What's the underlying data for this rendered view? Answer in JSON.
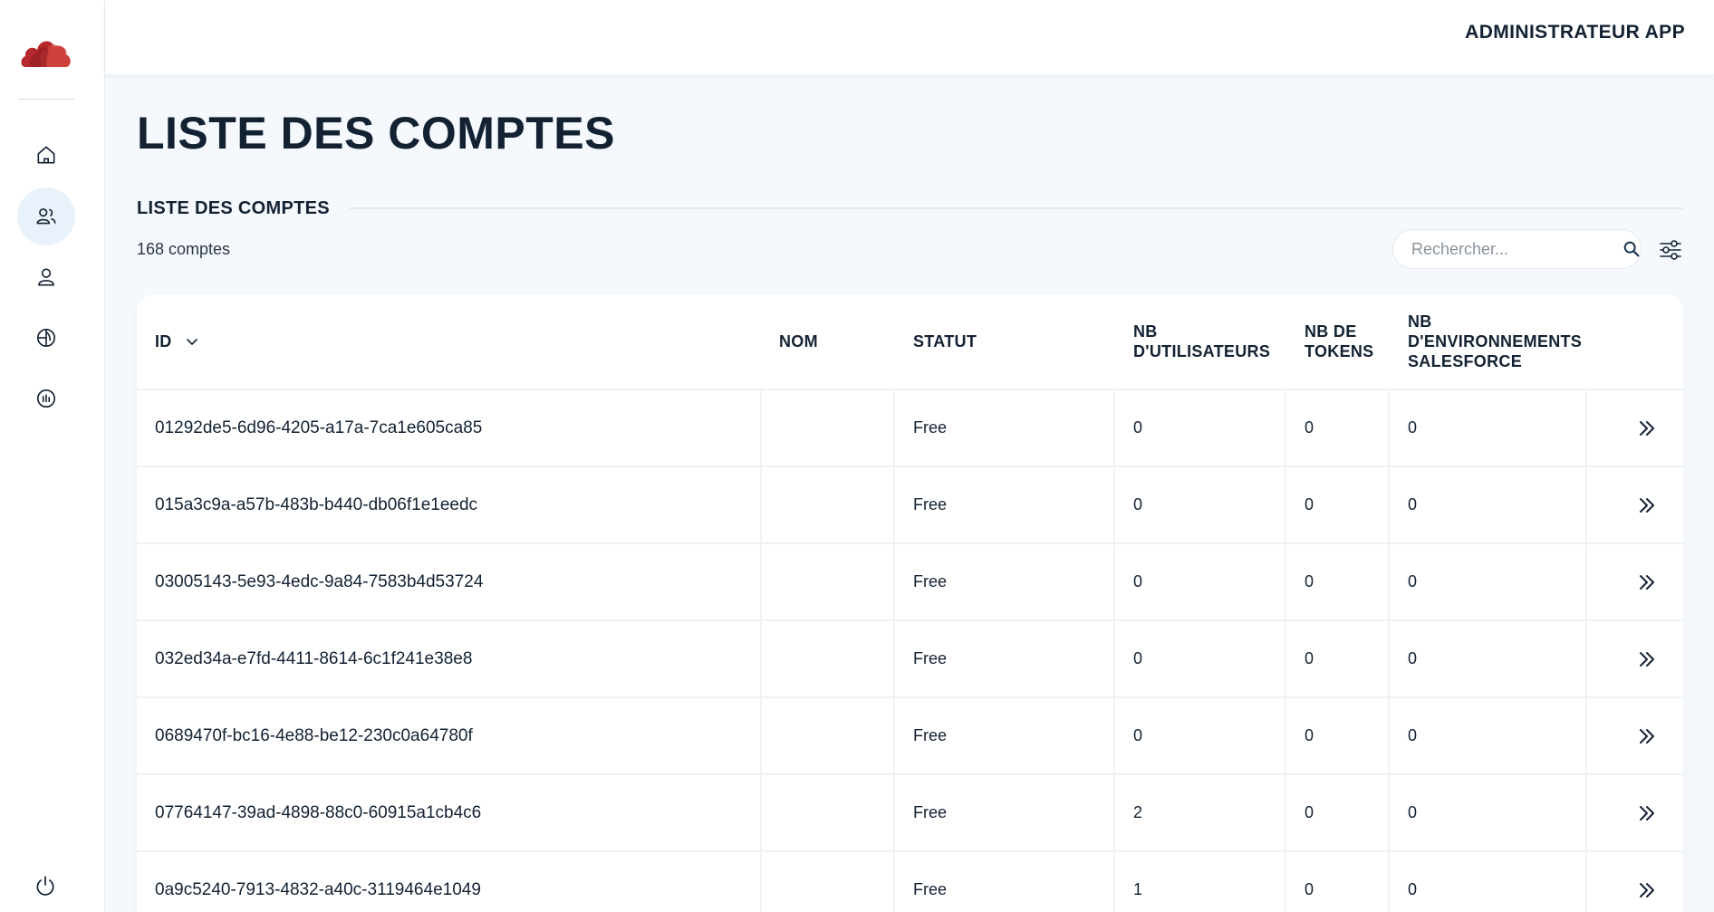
{
  "app": {
    "user_label": "ADMINISTRATEUR APP"
  },
  "sidebar": {
    "items": [
      {
        "name": "home",
        "icon": "home-icon",
        "active": false
      },
      {
        "name": "accounts",
        "icon": "users-icon",
        "active": true
      },
      {
        "name": "user",
        "icon": "user-icon",
        "active": false
      },
      {
        "name": "environments",
        "icon": "globe-icon",
        "active": false
      },
      {
        "name": "stats",
        "icon": "stats-icon",
        "active": false
      }
    ],
    "logout_icon": "power-icon"
  },
  "page": {
    "title": "LISTE DES COMPTES",
    "section_title": "LISTE DES COMPTES",
    "count_label": "168 comptes"
  },
  "search": {
    "placeholder": "Rechercher...",
    "value": ""
  },
  "table": {
    "columns": {
      "id": "ID",
      "nom": "NOM",
      "statut": "STATUT",
      "users": "NB D'UTILISATEURS",
      "tokens": "NB DE TOKENS",
      "env": "NB D'ENVIRONNEMENTS SALESFORCE"
    },
    "rows": [
      {
        "id": "01292de5-6d96-4205-a17a-7ca1e605ca85",
        "nom": "",
        "statut": "Free",
        "users": "0",
        "tokens": "0",
        "env": "0"
      },
      {
        "id": "015a3c9a-a57b-483b-b440-db06f1e1eedc",
        "nom": "",
        "statut": "Free",
        "users": "0",
        "tokens": "0",
        "env": "0"
      },
      {
        "id": "03005143-5e93-4edc-9a84-7583b4d53724",
        "nom": "",
        "statut": "Free",
        "users": "0",
        "tokens": "0",
        "env": "0"
      },
      {
        "id": "032ed34a-e7fd-4411-8614-6c1f241e38e8",
        "nom": "",
        "statut": "Free",
        "users": "0",
        "tokens": "0",
        "env": "0"
      },
      {
        "id": "0689470f-bc16-4e88-be12-230c0a64780f",
        "nom": "",
        "statut": "Free",
        "users": "0",
        "tokens": "0",
        "env": "0"
      },
      {
        "id": "07764147-39ad-4898-88c0-60915a1cb4c6",
        "nom": "",
        "statut": "Free",
        "users": "2",
        "tokens": "0",
        "env": "0"
      },
      {
        "id": "0a9c5240-7913-4832-a40c-3119464e1049",
        "nom": "",
        "statut": "Free",
        "users": "1",
        "tokens": "0",
        "env": "0"
      }
    ]
  },
  "colors": {
    "accent_red": "#b5292d",
    "text_dark": "#132233",
    "active_bg": "#e9f1fb",
    "background": "#f5f8fc"
  }
}
